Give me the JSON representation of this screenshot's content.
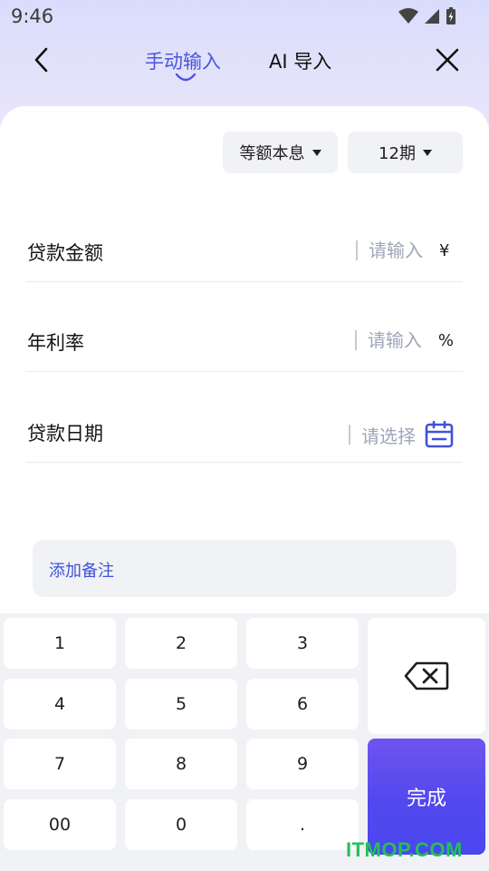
{
  "status_bar": {
    "time": "9:46"
  },
  "nav": {
    "tabs": [
      {
        "label": "手动输入",
        "active": true
      },
      {
        "label": "AI 导入",
        "active": false
      }
    ]
  },
  "options": {
    "method": "等额本息",
    "period": "12期"
  },
  "fields": [
    {
      "label": "贷款金额",
      "placeholder": "请输入",
      "unit": "¥"
    },
    {
      "label": "年利率",
      "placeholder": "请输入",
      "unit": "%"
    },
    {
      "label": "贷款日期",
      "placeholder": "请选择"
    }
  ],
  "note": {
    "label": "添加备注"
  },
  "keypad": {
    "keys": [
      "1",
      "2",
      "3",
      "4",
      "5",
      "6",
      "7",
      "8",
      "9",
      "00",
      "0",
      "."
    ],
    "done_label": "完成"
  },
  "watermark": "ITMOP.COM",
  "colors": {
    "accent": "#4a55e0",
    "done_button": "#5248ee",
    "placeholder": "#a0a6b8"
  }
}
